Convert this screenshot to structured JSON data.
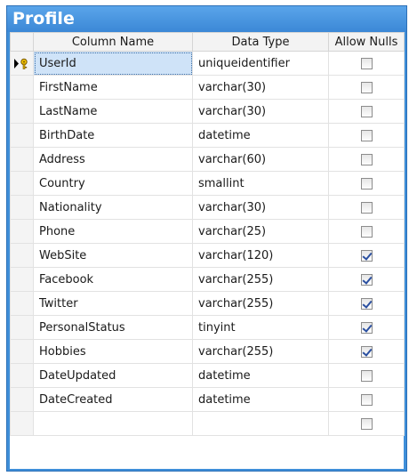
{
  "window": {
    "title": "Profile"
  },
  "grid": {
    "headers": {
      "name": "Column Name",
      "type": "Data Type",
      "nulls": "Allow Nulls"
    },
    "rows": [
      {
        "name": "UserId",
        "type": "uniqueidentifier",
        "allow_nulls": false,
        "primary_key": true,
        "selected": true
      },
      {
        "name": "FirstName",
        "type": "varchar(30)",
        "allow_nulls": false
      },
      {
        "name": "LastName",
        "type": "varchar(30)",
        "allow_nulls": false
      },
      {
        "name": "BirthDate",
        "type": "datetime",
        "allow_nulls": false
      },
      {
        "name": "Address",
        "type": "varchar(60)",
        "allow_nulls": false
      },
      {
        "name": "Country",
        "type": "smallint",
        "allow_nulls": false
      },
      {
        "name": "Nationality",
        "type": "varchar(30)",
        "allow_nulls": false
      },
      {
        "name": "Phone",
        "type": "varchar(25)",
        "allow_nulls": false
      },
      {
        "name": "WebSite",
        "type": "varchar(120)",
        "allow_nulls": true
      },
      {
        "name": "Facebook",
        "type": "varchar(255)",
        "allow_nulls": true
      },
      {
        "name": "Twitter",
        "type": "varchar(255)",
        "allow_nulls": true
      },
      {
        "name": "PersonalStatus",
        "type": "tinyint",
        "allow_nulls": true
      },
      {
        "name": "Hobbies",
        "type": "varchar(255)",
        "allow_nulls": true
      },
      {
        "name": "DateUpdated",
        "type": "datetime",
        "allow_nulls": false
      },
      {
        "name": "DateCreated",
        "type": "datetime",
        "allow_nulls": false
      },
      {
        "name": "",
        "type": "",
        "allow_nulls": false
      }
    ]
  },
  "icons": {
    "row_indicator": "current-row-arrow-icon",
    "primary_key": "key-icon"
  },
  "colors": {
    "title_bar": "#3f8fd9",
    "selection": "#cfe3f8",
    "check": "#2a4fa0"
  }
}
